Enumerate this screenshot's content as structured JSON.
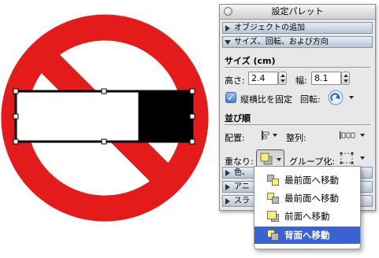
{
  "palette": {
    "title": "設定パレット",
    "sections": {
      "object_add": "オブジェクトの追加",
      "size_rotate": "サイズ、回転、および方向"
    },
    "size": {
      "group_title": "サイズ (cm)",
      "height_label": "高さ:",
      "height_value": "2.4",
      "width_label": "幅:",
      "width_value": "8.1",
      "lock_ratio_label": "縦横比を固定",
      "lock_ratio_checked": true,
      "rotate_label": "回転:"
    },
    "arrange": {
      "group_title": "並び順",
      "align_label": "配置:",
      "distribute_label": "整列:",
      "order_label": "重なり:",
      "group_label": "グループ化:"
    },
    "collapsed_sections": [
      "色、",
      "アニ",
      "スラ"
    ]
  },
  "order_menu": {
    "items": [
      {
        "label": "最前面へ移動",
        "icon": "bring-to-front-icon",
        "selected": false
      },
      {
        "label": "最前面へ移動",
        "icon": "bring-forward-icon",
        "selected": false
      },
      {
        "label": "前面へ移動",
        "icon": "send-backward-icon",
        "selected": false
      },
      {
        "label": "背面へ移動",
        "icon": "send-to-back-icon",
        "selected": true
      }
    ]
  },
  "colors": {
    "sign_red": "#e41b1b",
    "menu_highlight": "#3b62cf",
    "icon_yellow": "#f7ef7a"
  }
}
